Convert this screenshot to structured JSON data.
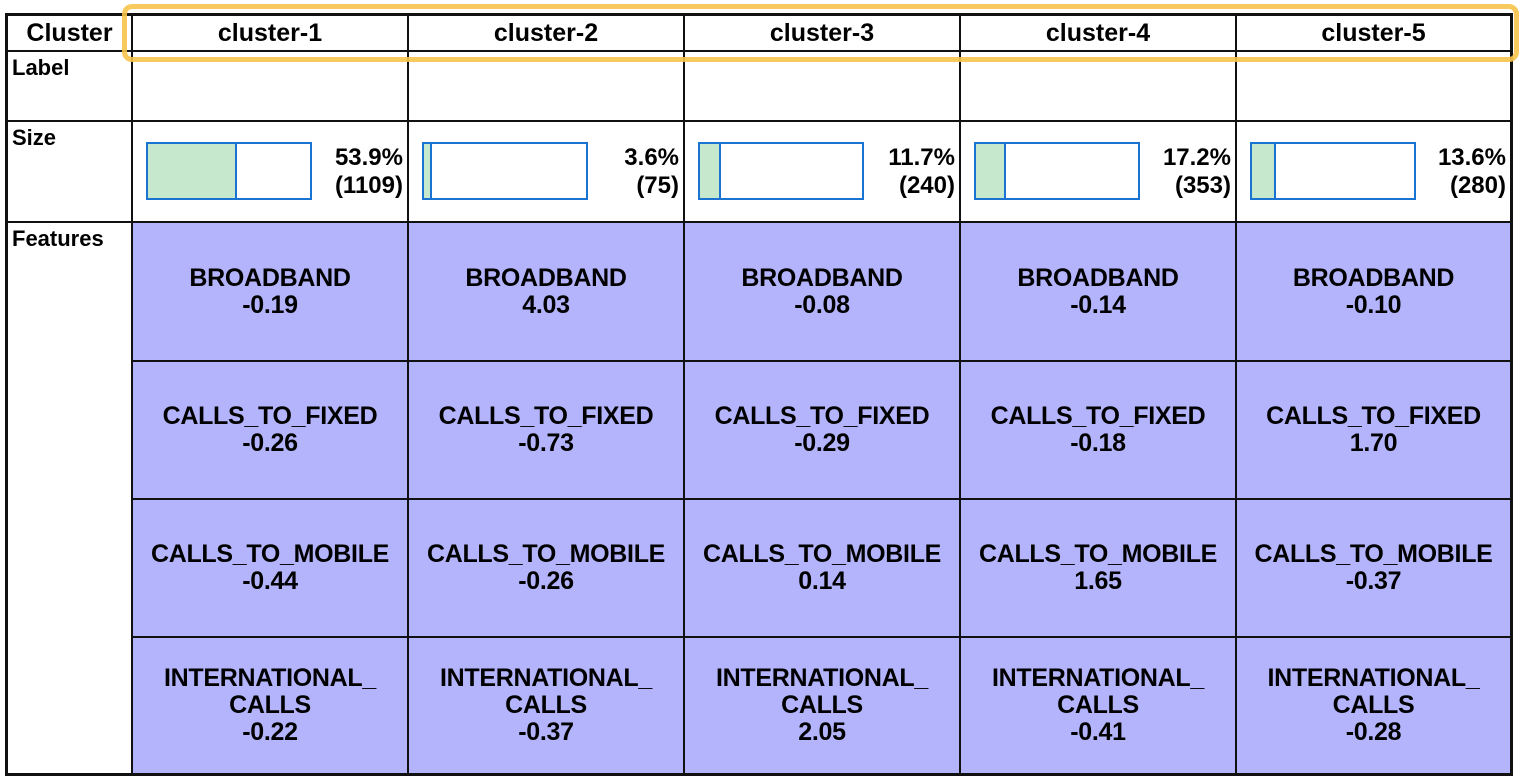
{
  "table": {
    "corner_label": "Cluster",
    "row_labels": {
      "label": "Label",
      "size": "Size",
      "features": "Features"
    },
    "clusters": [
      {
        "name": "cluster-1",
        "label": "",
        "size_percent": "53.9%",
        "size_count": "(1109)",
        "size_fraction": 0.539,
        "features": [
          {
            "name": "BROADBAND",
            "value": "-0.19"
          },
          {
            "name": "CALLS_TO_FIXED",
            "value": "-0.26"
          },
          {
            "name": "CALLS_TO_MOBILE",
            "value": "-0.44"
          },
          {
            "name": "INTERNATIONAL_ CALLS",
            "value": "-0.22"
          }
        ]
      },
      {
        "name": "cluster-2",
        "label": "",
        "size_percent": "3.6%",
        "size_count": "(75)",
        "size_fraction": 0.036,
        "features": [
          {
            "name": "BROADBAND",
            "value": "4.03"
          },
          {
            "name": "CALLS_TO_FIXED",
            "value": "-0.73"
          },
          {
            "name": "CALLS_TO_MOBILE",
            "value": "-0.26"
          },
          {
            "name": "INTERNATIONAL_ CALLS",
            "value": "-0.37"
          }
        ]
      },
      {
        "name": "cluster-3",
        "label": "",
        "size_percent": "11.7%",
        "size_count": "(240)",
        "size_fraction": 0.117,
        "features": [
          {
            "name": "BROADBAND",
            "value": "-0.08"
          },
          {
            "name": "CALLS_TO_FIXED",
            "value": "-0.29"
          },
          {
            "name": "CALLS_TO_MOBILE",
            "value": "0.14"
          },
          {
            "name": "INTERNATIONAL_ CALLS",
            "value": "2.05"
          }
        ]
      },
      {
        "name": "cluster-4",
        "label": "",
        "size_percent": "17.2%",
        "size_count": "(353)",
        "size_fraction": 0.172,
        "features": [
          {
            "name": "BROADBAND",
            "value": "-0.14"
          },
          {
            "name": "CALLS_TO_FIXED",
            "value": "-0.18"
          },
          {
            "name": "CALLS_TO_MOBILE",
            "value": "1.65"
          },
          {
            "name": "INTERNATIONAL_ CALLS",
            "value": "-0.41"
          }
        ]
      },
      {
        "name": "cluster-5",
        "label": "",
        "size_percent": "13.6%",
        "size_count": "(280)",
        "size_fraction": 0.136,
        "features": [
          {
            "name": "BROADBAND",
            "value": "-0.10"
          },
          {
            "name": "CALLS_TO_FIXED",
            "value": "1.70"
          },
          {
            "name": "CALLS_TO_MOBILE",
            "value": "-0.37"
          },
          {
            "name": "INTERNATIONAL_ CALLS",
            "value": "-0.28"
          }
        ]
      }
    ]
  },
  "colors": {
    "feature_cell_bg": "#b4b4fc",
    "size_bar_fill": "#c6e8cc",
    "size_bar_border": "#1a73d0",
    "highlight": "#f7c34a"
  }
}
